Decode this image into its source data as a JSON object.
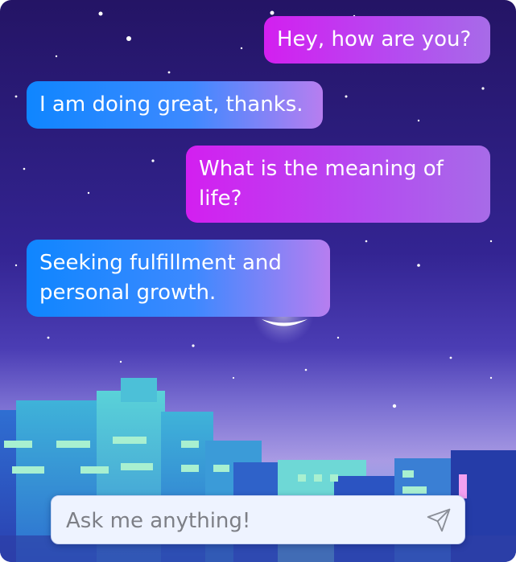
{
  "messages": [
    {
      "role": "user",
      "text": "Hey, how are you?"
    },
    {
      "role": "assistant",
      "text": "I am doing great, thanks."
    },
    {
      "role": "user",
      "text": "What is the meaning of life?"
    },
    {
      "role": "assistant",
      "text": "Seeking fulfillment and personal growth."
    }
  ],
  "composer": {
    "placeholder": "Ask me anything!",
    "send_icon": "send-icon"
  },
  "colors": {
    "user_bubble": "#d31ff0",
    "assistant_bubble": "#0f86ff",
    "sky_top": "#241465",
    "input_bg": "#eef3ff"
  }
}
